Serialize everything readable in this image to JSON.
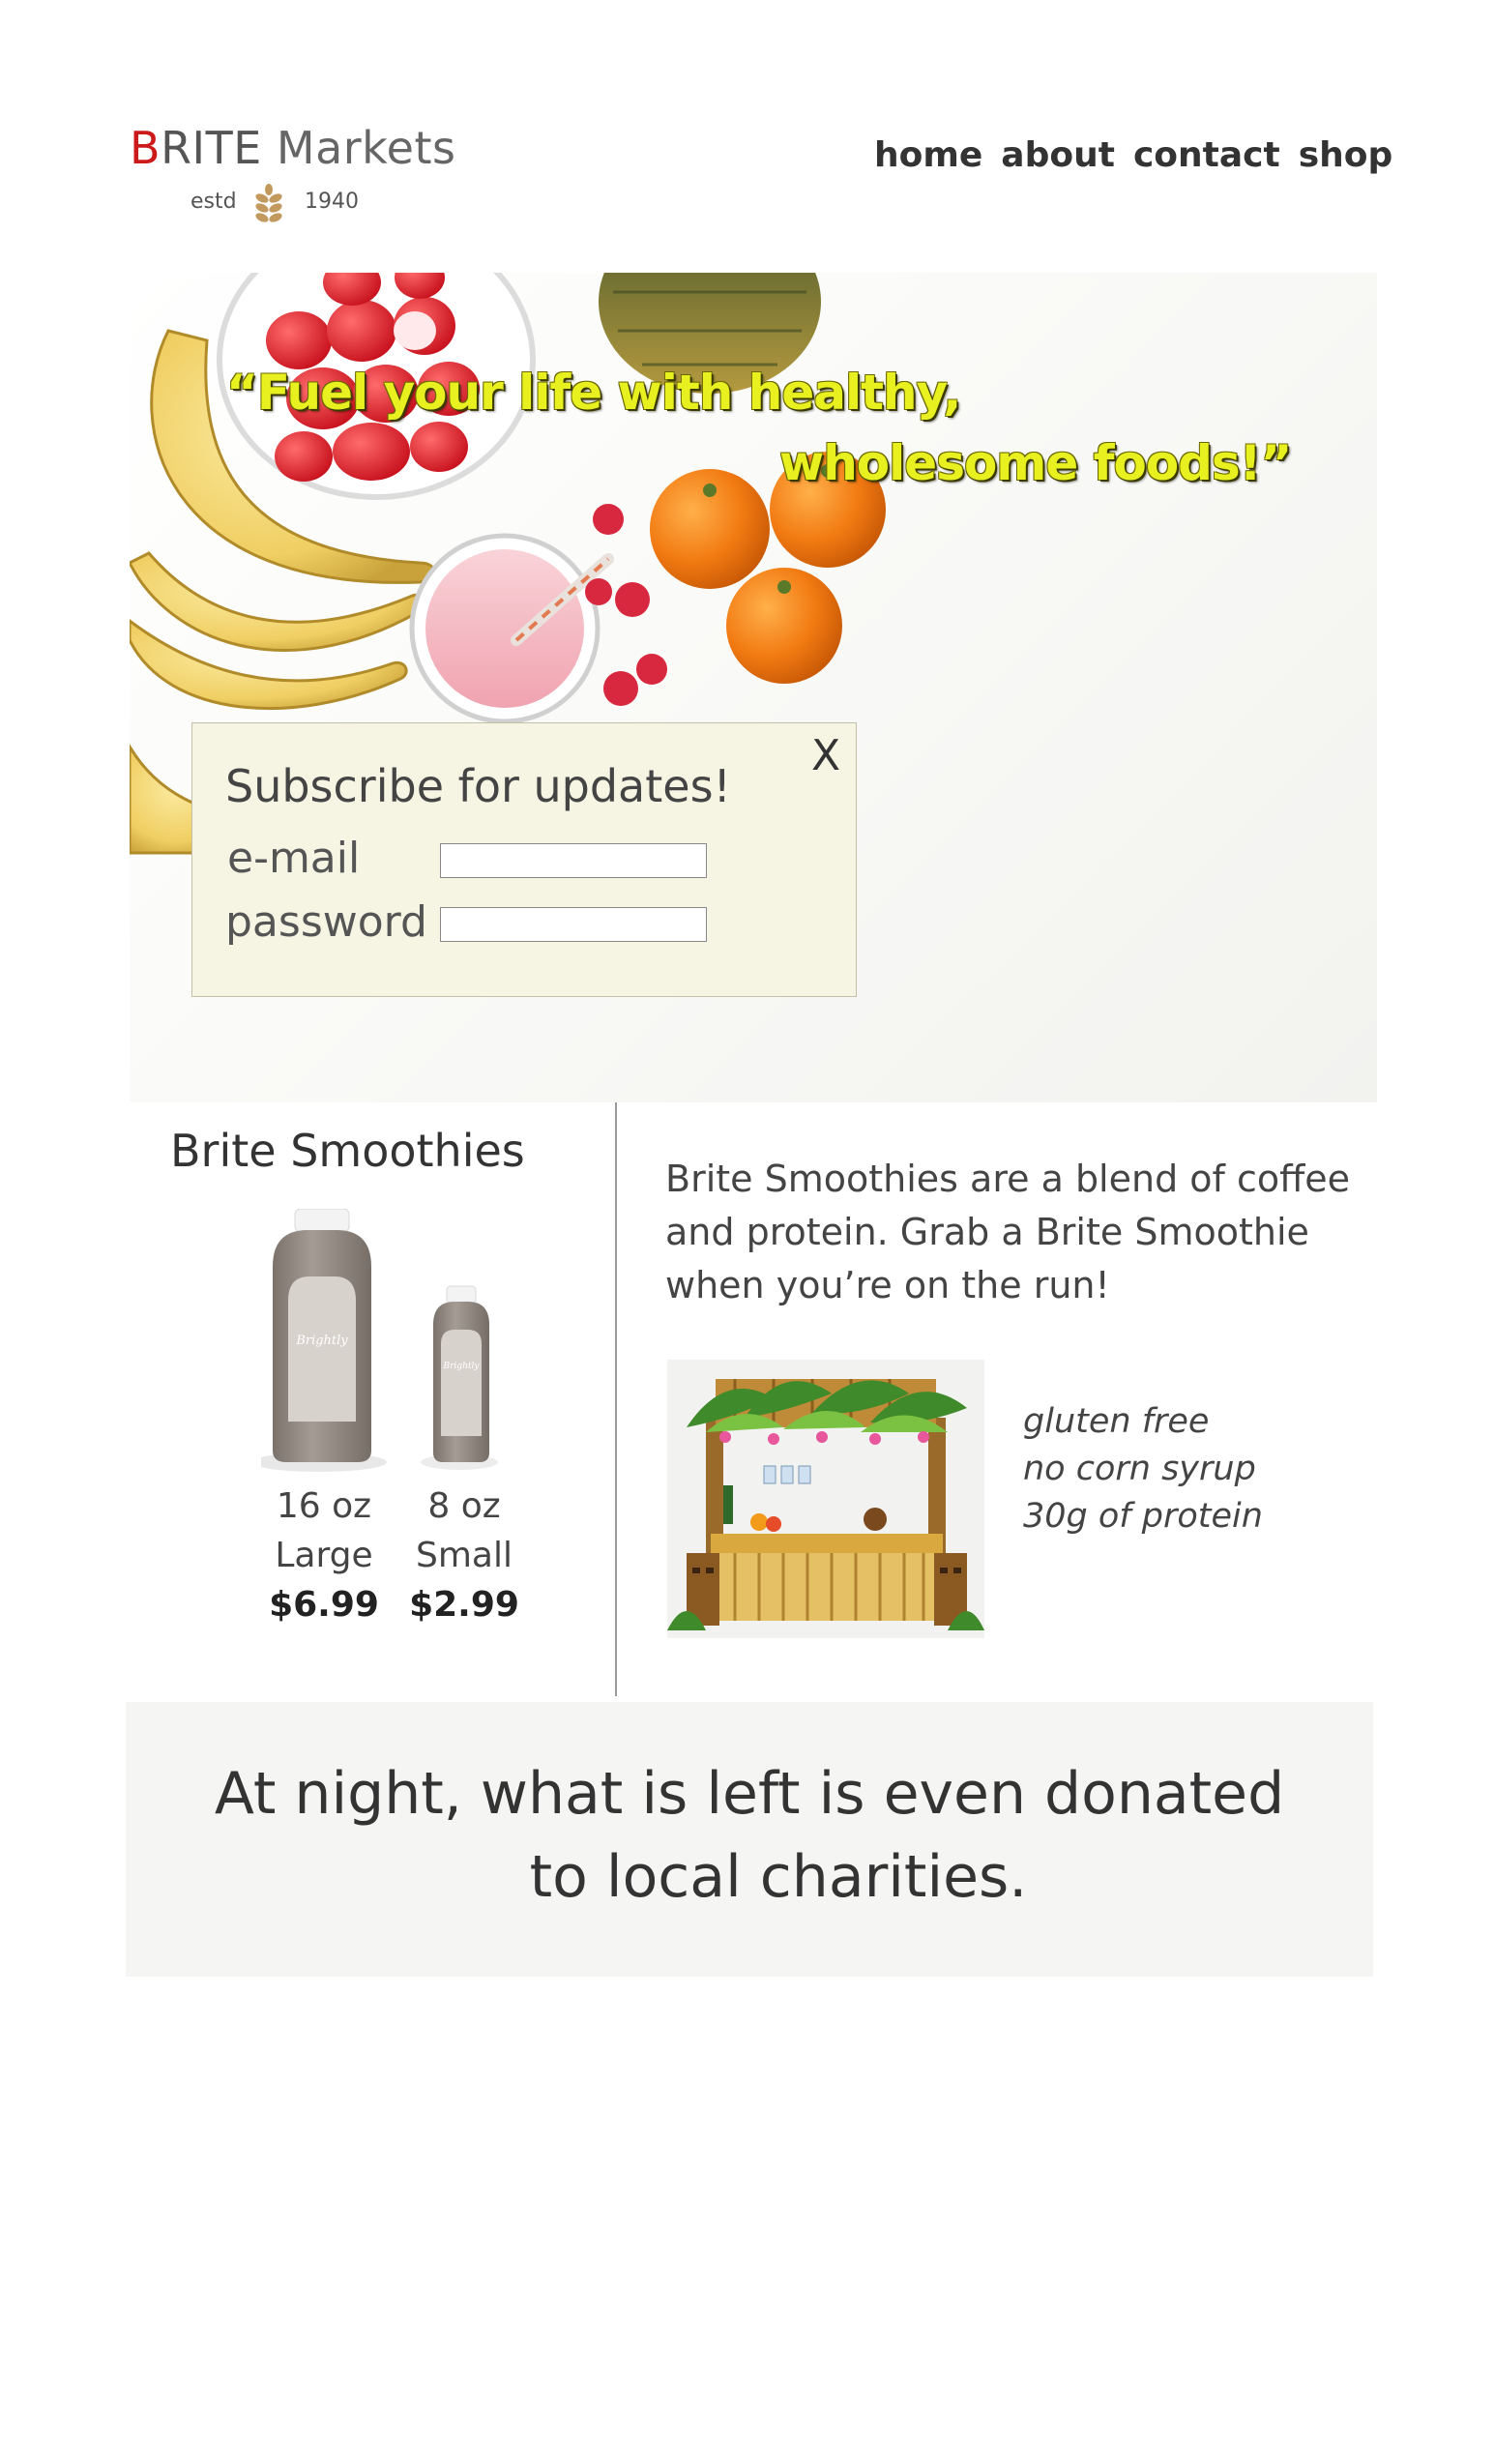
{
  "header": {
    "logo_first_letter": "B",
    "logo_rest": "RITE",
    "logo_second_word": "Markets",
    "estd_label": "estd",
    "estd_year": "1940",
    "logo_icon": "wheat-icon",
    "brand_red": "#cc1a1a"
  },
  "nav": {
    "items": [
      "home",
      "about",
      "contact",
      "shop"
    ]
  },
  "hero": {
    "quote_line1": "“Fuel your life with healthy,",
    "quote_line2": "wholesome foods!”",
    "quote_color": "#e8f020"
  },
  "subscribe": {
    "close_label": "X",
    "title": "Subscribe for updates!",
    "email_label": "e-mail",
    "email_value": "",
    "password_label": "password",
    "password_value": ""
  },
  "smoothies": {
    "title": "Brite Smoothies",
    "bottle_brand": "Brightly",
    "sizes": [
      {
        "oz": "16 oz",
        "name": "Large",
        "price": "$6.99"
      },
      {
        "oz": "8 oz",
        "name": "Small",
        "price": "$2.99"
      }
    ],
    "description": "Brite Smoothies are a blend of coffee and protein. Grab a Brite Smoothie when you’re on the run!",
    "features": [
      "gluten free",
      "no corn syrup",
      "30g of protein"
    ]
  },
  "banner": {
    "line1": "At night, what is left is even donated",
    "line2": "to local charities."
  }
}
